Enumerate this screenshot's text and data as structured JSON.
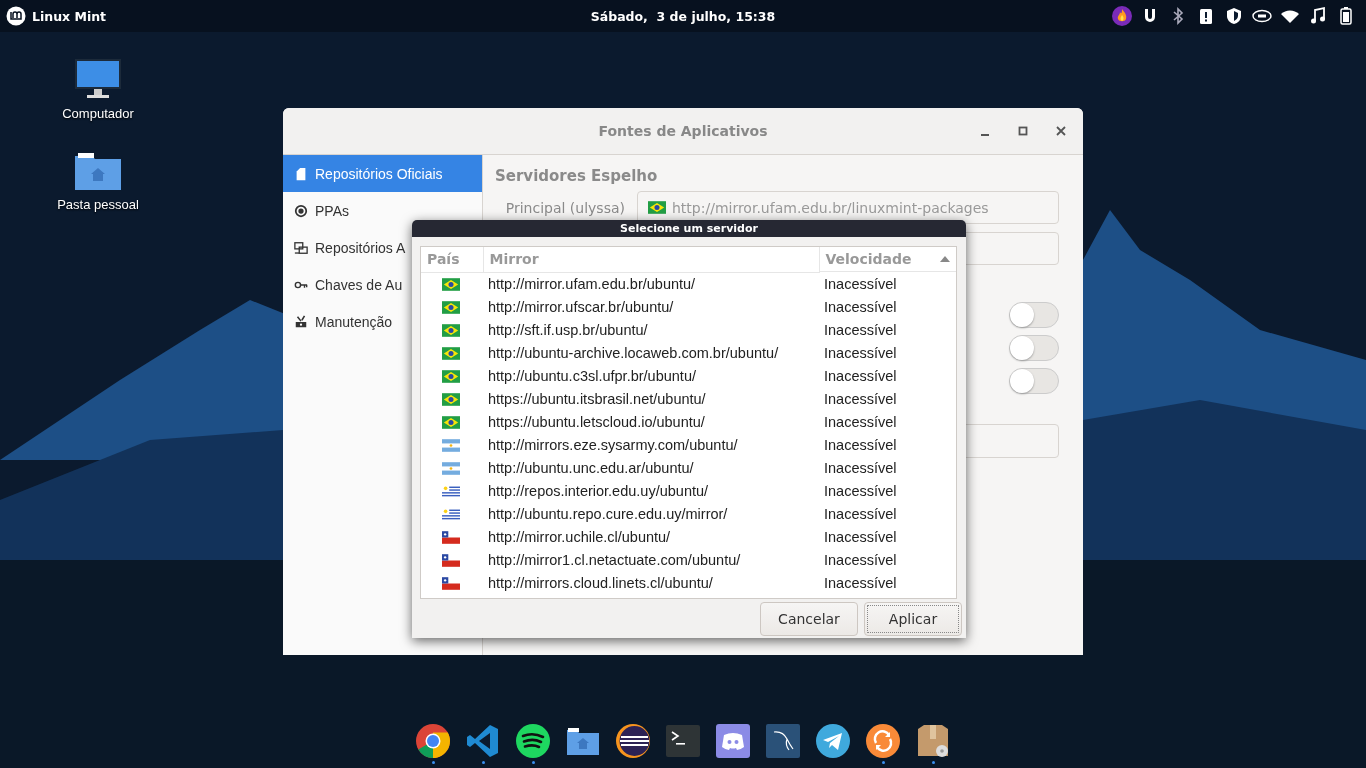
{
  "top_panel": {
    "menu_label": "Linux Mint",
    "clock": "Sábado,  3 de julho, 15:38",
    "tray": [
      {
        "kind": "flame"
      },
      {
        "kind": "magnet"
      },
      {
        "kind": "bluetooth"
      },
      {
        "kind": "clipboard"
      },
      {
        "kind": "shield"
      },
      {
        "kind": "chip"
      },
      {
        "kind": "wifi"
      },
      {
        "kind": "music"
      },
      {
        "kind": "battery"
      }
    ]
  },
  "desktop_icons": [
    {
      "kind": "computer",
      "label": "Computador"
    },
    {
      "kind": "folder",
      "label": "Pasta pessoal"
    }
  ],
  "window": {
    "title": "Fontes de Aplicativos",
    "sidebar": {
      "items": [
        {
          "kind": "official",
          "label": "Repositórios Oficiais",
          "selected": true
        },
        {
          "kind": "ppa",
          "label": "PPAs",
          "selected": false
        },
        {
          "kind": "network",
          "label": "Repositórios A",
          "selected": false
        },
        {
          "kind": "key",
          "label": "Chaves de Au",
          "selected": false
        },
        {
          "kind": "tools",
          "label": "Manutenção",
          "selected": false
        }
      ]
    },
    "section_title": "Servidores Espelho",
    "main_mirror": {
      "label": "Principal (ulyssa)",
      "kind": "br",
      "value": "http://mirror.ufam.edu.br/linuxmint-packages"
    },
    "toggles": [
      {
        "on": false
      },
      {
        "on": false
      },
      {
        "on": false
      }
    ]
  },
  "dialog": {
    "title": "Selecione um servidor",
    "columns": [
      {
        "label": "País",
        "sorted": false
      },
      {
        "label": "Mirror",
        "sorted": false
      },
      {
        "label": "Velocidade",
        "sorted": true
      }
    ],
    "rows": [
      {
        "kind": "br",
        "mirror": "http://mirror.ufam.edu.br/ubuntu/",
        "speed": "Inacessível",
        "selected": false
      },
      {
        "kind": "br",
        "mirror": "http://mirror.ufscar.br/ubuntu/",
        "speed": "Inacessível",
        "selected": false
      },
      {
        "kind": "br",
        "mirror": "http://sft.if.usp.br/ubuntu/",
        "speed": "Inacessível",
        "selected": false
      },
      {
        "kind": "br",
        "mirror": "http://ubuntu-archive.locaweb.com.br/ubuntu/",
        "speed": "Inacessível",
        "selected": false
      },
      {
        "kind": "br",
        "mirror": "http://ubuntu.c3sl.ufpr.br/ubuntu/",
        "speed": "Inacessível",
        "selected": false
      },
      {
        "kind": "br",
        "mirror": "https://ubuntu.itsbrasil.net/ubuntu/",
        "speed": "Inacessível",
        "selected": false
      },
      {
        "kind": "br",
        "mirror": "https://ubuntu.letscloud.io/ubuntu/",
        "speed": "Inacessível",
        "selected": false
      },
      {
        "kind": "ar",
        "mirror": "http://mirrors.eze.sysarmy.com/ubuntu/",
        "speed": "Inacessível",
        "selected": false
      },
      {
        "kind": "ar",
        "mirror": "http://ubuntu.unc.edu.ar/ubuntu/",
        "speed": "Inacessível",
        "selected": false
      },
      {
        "kind": "uy",
        "mirror": "http://repos.interior.edu.uy/ubuntu/",
        "speed": "Inacessível",
        "selected": false
      },
      {
        "kind": "uy",
        "mirror": "http://ubuntu.repo.cure.edu.uy/mirror/",
        "speed": "Inacessível",
        "selected": false
      },
      {
        "kind": "cl",
        "mirror": "http://mirror.uchile.cl/ubuntu/",
        "speed": "Inacessível",
        "selected": false
      },
      {
        "kind": "cl",
        "mirror": "http://mirror1.cl.netactuate.com/ubuntu/",
        "speed": "Inacessível",
        "selected": false
      },
      {
        "kind": "cl",
        "mirror": "http://mirrors.cloud.linets.cl/ubuntu/",
        "speed": "Inacessível",
        "selected": false
      }
    ],
    "buttons": [
      {
        "label": "Cancelar",
        "focused": false
      },
      {
        "label": "Aplicar",
        "focused": true
      }
    ]
  },
  "dock": [
    {
      "kind": "chrome",
      "running": true
    },
    {
      "kind": "vscode",
      "running": true
    },
    {
      "kind": "spotify",
      "running": true
    },
    {
      "kind": "files",
      "running": false
    },
    {
      "kind": "eclipse",
      "running": false
    },
    {
      "kind": "terminal",
      "running": false
    },
    {
      "kind": "discord",
      "running": false
    },
    {
      "kind": "mysql",
      "running": false
    },
    {
      "kind": "telegram",
      "running": false
    },
    {
      "kind": "sync",
      "running": true
    },
    {
      "kind": "package",
      "running": true
    }
  ]
}
